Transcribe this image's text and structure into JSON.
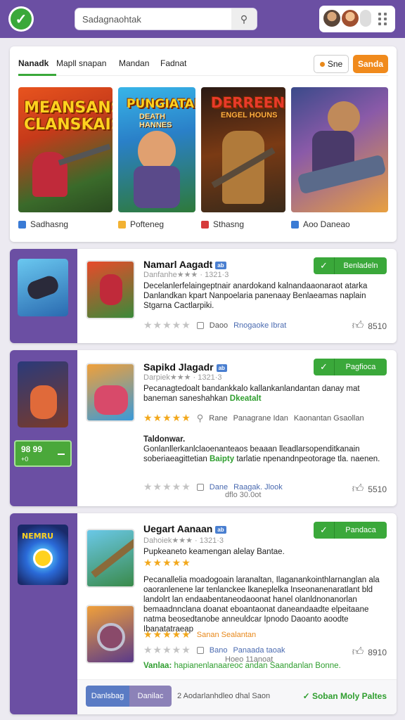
{
  "header": {
    "search_placeholder": "Sadagnaohtak",
    "accent": "#6b4fa3",
    "icons": [
      "check-icon",
      "search-icon",
      "grid-icon"
    ]
  },
  "featured": {
    "tabs": [
      "Nanadk",
      "Mapll snapan",
      "Mandan",
      "Fadnat"
    ],
    "btn_outline": "Sne",
    "btn_orange": "Sanda",
    "art_title_1": "MEANSANS CLANSKAIS",
    "art_title_2": "PUNGIATAN",
    "art_sub_2": "DEATH HANNES",
    "art_title_3": "DERREENG",
    "art_sub_3": "ENGEL HOUNS",
    "captions": [
      "Sadhasng",
      "Pofteneg",
      "Sthasng",
      "Aoo Daneao"
    ]
  },
  "cards": [
    {
      "title": "Namarl Aagadt",
      "badge": "ab",
      "meta": "Danfanhe★★★ · 1321·3",
      "desc": "Decelanlerfelaingeptnair anardokand kalnandaaonaraot atarka Danlandkan kpart Nanpoelaria panenaay Benlaeamas naplain Stgarna Cactlarpiki.",
      "stars": "★★★★★",
      "tag1": "Daoo",
      "tag2": "Rnogaoke Ibrat",
      "likes": "8510",
      "button": "Benladeln"
    },
    {
      "title": "Sapikd Jlagadr",
      "badge": "ab",
      "meta": "Darpiek★★★ · 1321·3",
      "desc": "Pecanagtedoalt bandankkalo kallankanlandantan danay mat baneman saneshahkan",
      "desc_hl": "Dkeatalt",
      "stars": "★★★★★",
      "tag1": "Rane",
      "tag2": "Panagrane Idan",
      "tag3": "Kaonantan Gsaollan",
      "subhead": "Taldonwar.",
      "desc2": "Gonlanllerkanlclaoenanteaos beaaan lleadlarsopenditkanain soberiaeagittetian",
      "desc2_hl": "Baipty",
      "desc2_rest": "tarlatie npenandnpeotorage tla. naenen.",
      "tag4": "Dane",
      "tag5": "Raagak. Jlook",
      "tag6": "dflo 30.0ot",
      "likes": "5510",
      "button": "Pagfioca",
      "price_main": "98 99",
      "price_sub": "+0"
    },
    {
      "title": "Uegart Aanaan",
      "badge": "ab",
      "meta": "Dahoiek★★★ · 1321·3",
      "desc_short": "Pupkeaneto keamengan alelay Bantae.",
      "desc": "Pecanallelia moadogoain laranaltan, Ilaganankointhlarnanglan ala oaoranlenene lar tenlanckee lkaneplelka Inseonanenaratlant bld landolrt lan endaabentaneodaoonat hanel olanldnonanorlan bemaadnnclana doanat eboantaonat daneandaadte elpeitaane natma beosedtanobe anneuldcar Ipnodo Daoanto aoodte Ibanatatraeap",
      "stars": "★★★★★",
      "stars_hl": "Sanan Sealantan",
      "tag1": "Bano",
      "tag2": "Panaada taoak",
      "tag3": "Hoeo 11anoat",
      "green_line_label": "Vanlaa:",
      "green_line": "hapianenlanaareoc andan Saandanlan Bonne.",
      "likes": "8910",
      "button": "Pandaca",
      "bottom_btn1": "Danlsbag",
      "bottom_btn2": "Danilac",
      "bottom_text": "2 Aodarlanhdleo dhal Saon",
      "bottom_link": "Soban Moly Paltes"
    }
  ]
}
